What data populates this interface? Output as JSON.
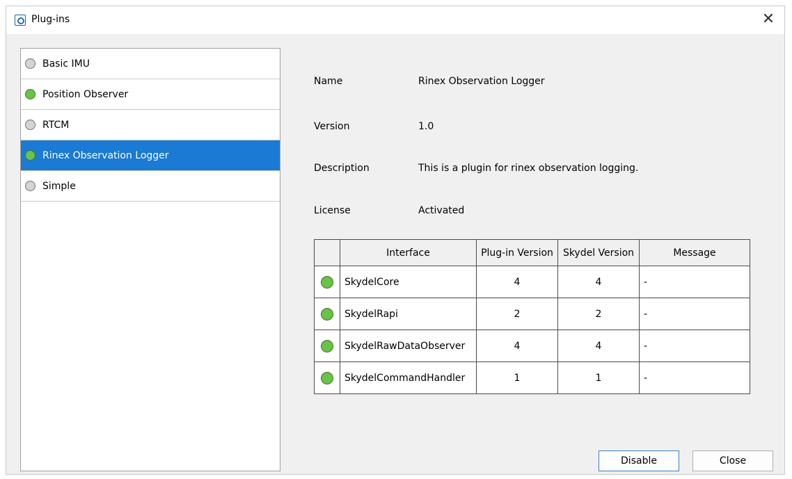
{
  "window": {
    "title": "Plug-ins",
    "close_glyph": "✕"
  },
  "plugins": [
    {
      "label": "Basic IMU",
      "status": "inactive"
    },
    {
      "label": "Position Observer",
      "status": "active"
    },
    {
      "label": "RTCM",
      "status": "inactive"
    },
    {
      "label": "Rinex Observation Logger",
      "status": "active",
      "selected": true
    },
    {
      "label": "Simple",
      "status": "inactive"
    }
  ],
  "details": {
    "name_label": "Name",
    "name_value": "Rinex Observation Logger",
    "version_label": "Version",
    "version_value": "1.0",
    "description_label": "Description",
    "description_value": "This is a plugin for rinex observation logging.",
    "license_label": "License",
    "license_value": "Activated"
  },
  "interfaces": {
    "headers": [
      "",
      "Interface",
      "Plug-in Version",
      "Skydel Version",
      "Message"
    ],
    "rows": [
      {
        "status": "active",
        "interface": "SkydelCore",
        "plugin_version": "4",
        "skydel_version": "4",
        "message": "-"
      },
      {
        "status": "active",
        "interface": "SkydelRapi",
        "plugin_version": "2",
        "skydel_version": "2",
        "message": "-"
      },
      {
        "status": "active",
        "interface": "SkydelRawDataObserver",
        "plugin_version": "4",
        "skydel_version": "4",
        "message": "-"
      },
      {
        "status": "active",
        "interface": "SkydelCommandHandler",
        "plugin_version": "1",
        "skydel_version": "1",
        "message": "-"
      }
    ]
  },
  "buttons": {
    "disable": "Disable",
    "close": "Close"
  },
  "colors": {
    "selection": "#1a7ad4",
    "active_dot": "#6ac24b",
    "inactive_dot": "#d4d4d4"
  }
}
